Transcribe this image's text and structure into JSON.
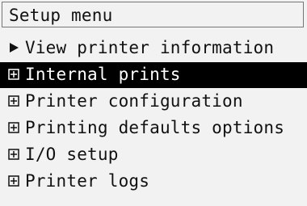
{
  "title": "Setup menu",
  "menu": {
    "items": [
      {
        "label": "View printer information",
        "icon": "arrow-right-icon",
        "selected": false
      },
      {
        "label": "Internal prints",
        "icon": "plus-box-icon",
        "selected": true
      },
      {
        "label": "Printer configuration",
        "icon": "plus-box-icon",
        "selected": false
      },
      {
        "label": "Printing defaults options",
        "icon": "plus-box-icon",
        "selected": false
      },
      {
        "label": "I/O setup",
        "icon": "plus-box-icon",
        "selected": false
      },
      {
        "label": "Printer logs",
        "icon": "plus-box-icon",
        "selected": false
      }
    ]
  },
  "colors": {
    "background": "#f2f2f2",
    "text": "#111111",
    "selected_background": "#000000",
    "selected_text": "#ffffff",
    "title_border": "#777777"
  }
}
